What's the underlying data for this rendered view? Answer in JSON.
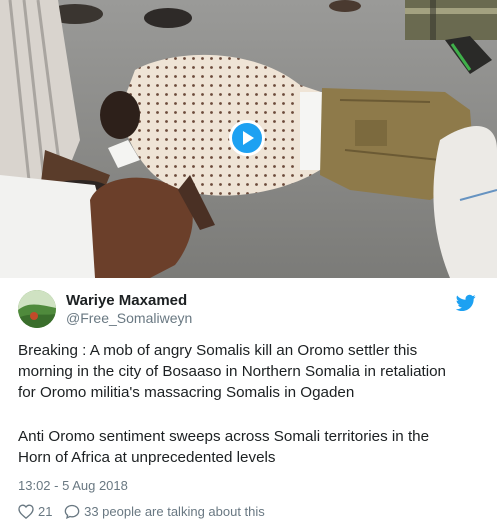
{
  "colors": {
    "accent": "#1da1f2",
    "text": "#1c2022",
    "muted": "#697882"
  },
  "media": {
    "play_icon": "play-icon"
  },
  "author": {
    "display_name": "Wariye Maxamed",
    "handle": "@Free_Somaliweyn",
    "avatar_icon": "avatar-image",
    "brand_icon": "twitter-bird-icon"
  },
  "tweet": {
    "paragraph_1": "Breaking : A mob of angry Somalis kill an Oromo settler this\nmorning in the city of Bosaaso in Northern Somalia in retaliation\nfor Oromo militia's massacring Somalis in Ogaden",
    "paragraph_2": "Anti Oromo sentiment sweeps across Somali territories in the\nHorn of Africa at unprecedented levels",
    "timestamp": "13:02 - 5 Aug 2018"
  },
  "actions": {
    "like_count": "21",
    "like_icon": "heart-icon",
    "talking_text": "33 people are talking about this",
    "talking_icon": "speech-bubble-icon"
  }
}
